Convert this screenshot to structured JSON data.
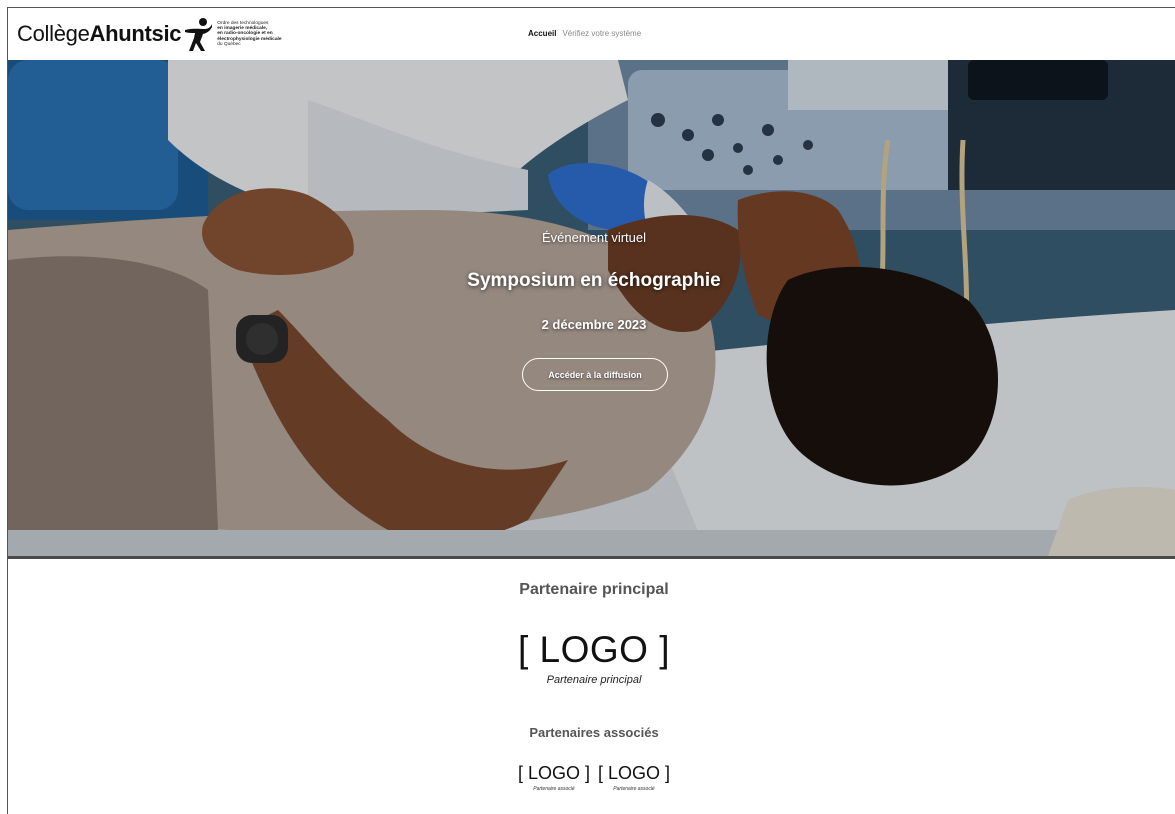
{
  "header": {
    "logo": {
      "word_regular": "Collège",
      "word_bold": "Ahuntsic",
      "ordre_lines": [
        {
          "text": "Ordre des technologues",
          "bold": false
        },
        {
          "text": "en imagerie médicale,",
          "bold": true
        },
        {
          "text": "en radio-oncologie et en",
          "bold": true
        },
        {
          "text": "électrophysiologie médicale",
          "bold": true
        },
        {
          "text": "du Québec",
          "bold": false
        }
      ]
    },
    "nav": {
      "home": "Accueil",
      "check_system": "Vérifiez votre système"
    }
  },
  "hero": {
    "eyebrow": "Événement virtuel",
    "title": "Symposium en échographie",
    "date": "2 décembre 2023",
    "cta": "Accéder à la diffusion"
  },
  "partners": {
    "main_heading": "Partenaire principal",
    "main_logo": "[ LOGO ]",
    "main_caption": "Partenaire principal",
    "associated_heading": "Partenaires associés",
    "associated": [
      {
        "logo": "[ LOGO ]",
        "caption": "Partenaire associé"
      },
      {
        "logo": "[ LOGO ]",
        "caption": "Partenaire associé"
      }
    ]
  }
}
